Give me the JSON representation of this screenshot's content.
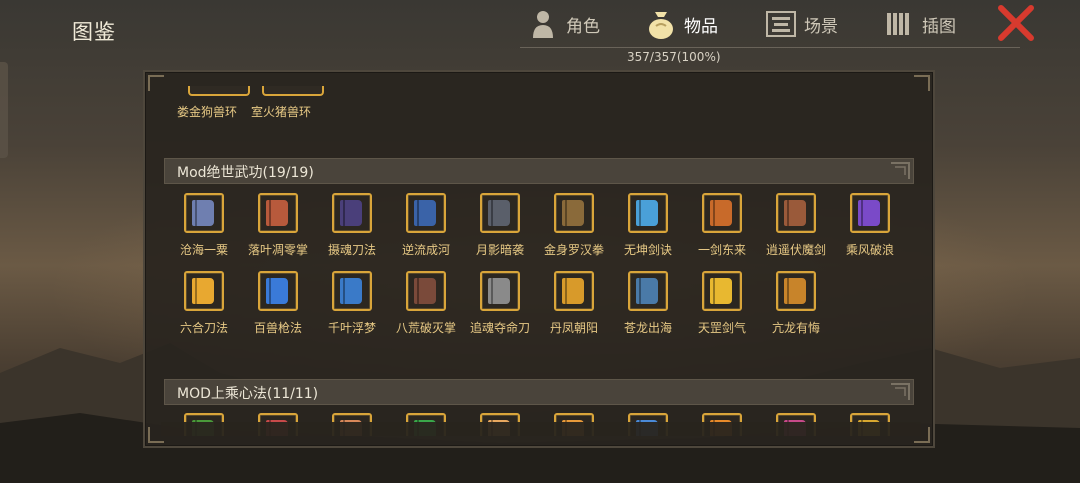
{
  "header": {
    "title": "图鉴",
    "tabs": [
      {
        "label": "角色",
        "icon": "character-icon",
        "active": false
      },
      {
        "label": "物品",
        "icon": "item-bag-icon",
        "active": true
      },
      {
        "label": "场景",
        "icon": "scene-icon",
        "active": false
      },
      {
        "label": "插图",
        "icon": "illustration-icon",
        "active": false
      }
    ],
    "progress": "357/357(100%)",
    "close_icon": "close-icon"
  },
  "colors": {
    "accent_gold": "#d9a53a",
    "item_label": "#e7c985",
    "close_red": "#d83a2e"
  },
  "top_partial_items": [
    "娄金狗兽环",
    "室火猪兽环"
  ],
  "sections": [
    {
      "title": "Mod绝世武功(19/19)",
      "items": [
        {
          "label": "沧海一粟",
          "color": "#6f7fb0"
        },
        {
          "label": "落叶凋零掌",
          "color": "#b85a3c"
        },
        {
          "label": "摄魂刀法",
          "color": "#4a3f7a"
        },
        {
          "label": "逆流成河",
          "color": "#3a63a8"
        },
        {
          "label": "月影暗袭",
          "color": "#5a5f6a"
        },
        {
          "label": "金身罗汉拳",
          "color": "#8a6a3a"
        },
        {
          "label": "无坤剑诀",
          "color": "#4aa0d8"
        },
        {
          "label": "一剑东来",
          "color": "#c86a2a"
        },
        {
          "label": "逍遥伏魔剑",
          "color": "#9a5a3a"
        },
        {
          "label": "乘风破浪",
          "color": "#7a4ac8"
        },
        {
          "label": "六合刀法",
          "color": "#e8a830"
        },
        {
          "label": "百兽枪法",
          "color": "#3a7ad8"
        },
        {
          "label": "千叶浮梦",
          "color": "#3a7ac8"
        },
        {
          "label": "八荒破灭掌",
          "color": "#7a4a3a"
        },
        {
          "label": "追魂夺命刀",
          "color": "#8a8a8a"
        },
        {
          "label": "丹凤朝阳",
          "color": "#d89a2a"
        },
        {
          "label": "苍龙出海",
          "color": "#4a7aa8"
        },
        {
          "label": "天罡剑气",
          "color": "#e8b830"
        },
        {
          "label": "亢龙有悔",
          "color": "#c8842a"
        }
      ]
    },
    {
      "title": "MOD上乘心法(11/11)",
      "items": [
        {
          "label": "",
          "color": "#4a9a3a"
        },
        {
          "label": "",
          "color": "#c84a4a"
        },
        {
          "label": "",
          "color": "#d8885a"
        },
        {
          "label": "",
          "color": "#3aa84a"
        },
        {
          "label": "",
          "color": "#e8a860"
        },
        {
          "label": "",
          "color": "#e89a3a"
        },
        {
          "label": "",
          "color": "#4a8ad8"
        },
        {
          "label": "",
          "color": "#e88a2a"
        },
        {
          "label": "",
          "color": "#c84a8a"
        },
        {
          "label": "",
          "color": "#d8a830"
        }
      ]
    }
  ]
}
